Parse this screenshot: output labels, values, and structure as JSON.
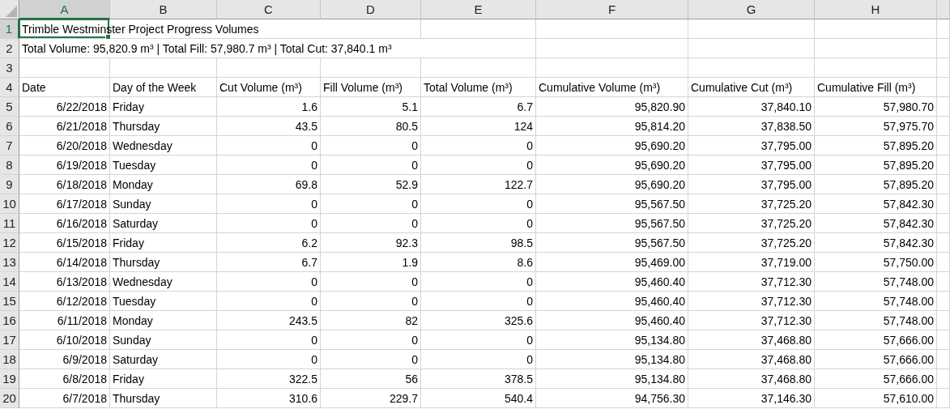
{
  "columns": [
    {
      "label": "A",
      "selected": true
    },
    {
      "label": "B",
      "selected": false
    },
    {
      "label": "C",
      "selected": false
    },
    {
      "label": "D",
      "selected": false
    },
    {
      "label": "E",
      "selected": false
    },
    {
      "label": "F",
      "selected": false
    },
    {
      "label": "G",
      "selected": false
    },
    {
      "label": "H",
      "selected": false
    }
  ],
  "rows": [
    {
      "number": "1",
      "selected": true,
      "kind": "title",
      "text": "Trimble Westminster Project Progress Volumes"
    },
    {
      "number": "2",
      "selected": false,
      "kind": "title",
      "text": "Total Volume: 95,820.9 m³ | Total Fill: 57,980.7 m³ | Total Cut: 37,840.1 m³"
    },
    {
      "number": "3",
      "selected": false,
      "kind": "empty"
    },
    {
      "number": "4",
      "selected": false,
      "kind": "header",
      "cells": [
        "Date",
        "Day of the Week",
        "Cut Volume (m³)",
        "Fill Volume (m³)",
        "Total Volume (m³)",
        "Cumulative Volume (m³)",
        "Cumulative Cut (m³)",
        "Cumulative Fill (m³)"
      ]
    },
    {
      "number": "5",
      "selected": false,
      "kind": "data",
      "cells": [
        "6/22/2018",
        "Friday",
        "1.6",
        "5.1",
        "6.7",
        "95,820.90",
        "37,840.10",
        "57,980.70"
      ]
    },
    {
      "number": "6",
      "selected": false,
      "kind": "data",
      "cells": [
        "6/21/2018",
        "Thursday",
        "43.5",
        "80.5",
        "124",
        "95,814.20",
        "37,838.50",
        "57,975.70"
      ]
    },
    {
      "number": "7",
      "selected": false,
      "kind": "data",
      "cells": [
        "6/20/2018",
        "Wednesday",
        "0",
        "0",
        "0",
        "95,690.20",
        "37,795.00",
        "57,895.20"
      ]
    },
    {
      "number": "8",
      "selected": false,
      "kind": "data",
      "cells": [
        "6/19/2018",
        "Tuesday",
        "0",
        "0",
        "0",
        "95,690.20",
        "37,795.00",
        "57,895.20"
      ]
    },
    {
      "number": "9",
      "selected": false,
      "kind": "data",
      "cells": [
        "6/18/2018",
        "Monday",
        "69.8",
        "52.9",
        "122.7",
        "95,690.20",
        "37,795.00",
        "57,895.20"
      ]
    },
    {
      "number": "10",
      "selected": false,
      "kind": "data",
      "cells": [
        "6/17/2018",
        "Sunday",
        "0",
        "0",
        "0",
        "95,567.50",
        "37,725.20",
        "57,842.30"
      ]
    },
    {
      "number": "11",
      "selected": false,
      "kind": "data",
      "cells": [
        "6/16/2018",
        "Saturday",
        "0",
        "0",
        "0",
        "95,567.50",
        "37,725.20",
        "57,842.30"
      ]
    },
    {
      "number": "12",
      "selected": false,
      "kind": "data",
      "cells": [
        "6/15/2018",
        "Friday",
        "6.2",
        "92.3",
        "98.5",
        "95,567.50",
        "37,725.20",
        "57,842.30"
      ]
    },
    {
      "number": "13",
      "selected": false,
      "kind": "data",
      "cells": [
        "6/14/2018",
        "Thursday",
        "6.7",
        "1.9",
        "8.6",
        "95,469.00",
        "37,719.00",
        "57,750.00"
      ]
    },
    {
      "number": "14",
      "selected": false,
      "kind": "data",
      "cells": [
        "6/13/2018",
        "Wednesday",
        "0",
        "0",
        "0",
        "95,460.40",
        "37,712.30",
        "57,748.00"
      ]
    },
    {
      "number": "15",
      "selected": false,
      "kind": "data",
      "cells": [
        "6/12/2018",
        "Tuesday",
        "0",
        "0",
        "0",
        "95,460.40",
        "37,712.30",
        "57,748.00"
      ]
    },
    {
      "number": "16",
      "selected": false,
      "kind": "data",
      "cells": [
        "6/11/2018",
        "Monday",
        "243.5",
        "82",
        "325.6",
        "95,460.40",
        "37,712.30",
        "57,748.00"
      ]
    },
    {
      "number": "17",
      "selected": false,
      "kind": "data",
      "cells": [
        "6/10/2018",
        "Sunday",
        "0",
        "0",
        "0",
        "95,134.80",
        "37,468.80",
        "57,666.00"
      ]
    },
    {
      "number": "18",
      "selected": false,
      "kind": "data",
      "cells": [
        "6/9/2018",
        "Saturday",
        "0",
        "0",
        "0",
        "95,134.80",
        "37,468.80",
        "57,666.00"
      ]
    },
    {
      "number": "19",
      "selected": false,
      "kind": "data",
      "cells": [
        "6/8/2018",
        "Friday",
        "322.5",
        "56",
        "378.5",
        "95,134.80",
        "37,468.80",
        "57,666.00"
      ]
    },
    {
      "number": "20",
      "selected": false,
      "kind": "data",
      "cells": [
        "6/7/2018",
        "Thursday",
        "310.6",
        "229.7",
        "540.4",
        "94,756.30",
        "37,146.30",
        "57,610.00"
      ]
    }
  ]
}
